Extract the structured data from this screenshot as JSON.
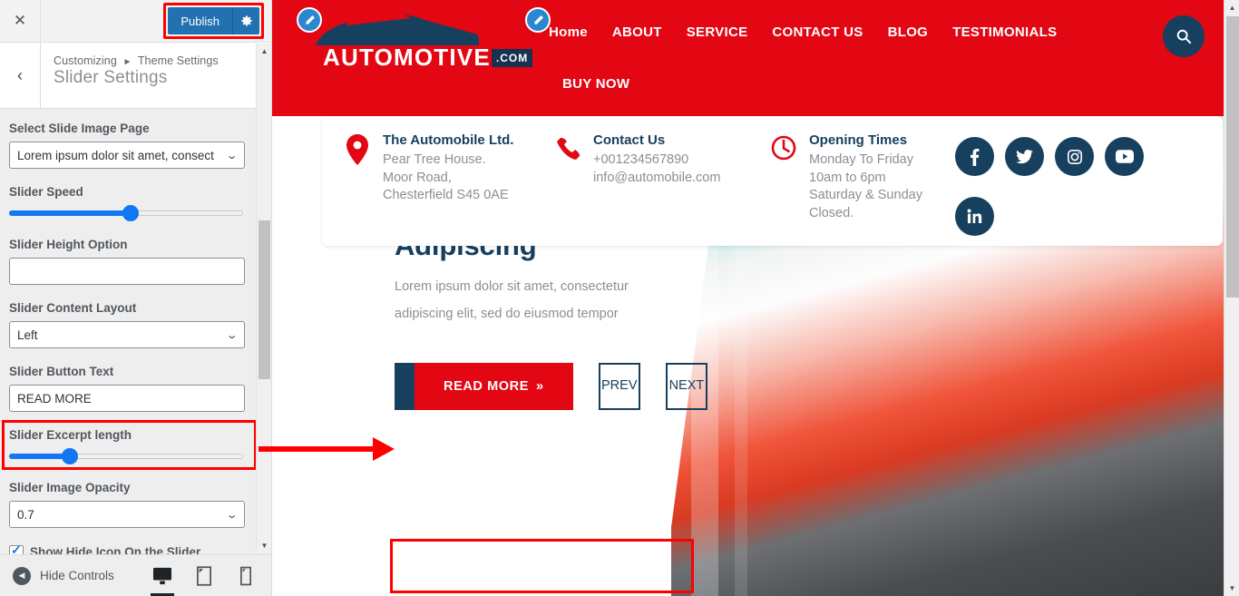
{
  "customizer": {
    "close_label": "✕",
    "publish_label": "Publish",
    "gear_icon": "gear-icon",
    "back_label": "‹",
    "breadcrumb_root": "Customizing",
    "breadcrumb_sep": "►",
    "breadcrumb_section": "Theme Settings",
    "panel_title": "Slider Settings",
    "controls": [
      {
        "label": "Select Slide Image Page",
        "type": "select",
        "value": "Lorem ipsum dolor sit amet, consect"
      },
      {
        "label": "Slider Speed",
        "type": "range",
        "percent": 52
      },
      {
        "label": "Slider Height Option",
        "type": "text",
        "value": ""
      },
      {
        "label": "Slider Content Layout",
        "type": "select",
        "value": "Left"
      },
      {
        "label": "Slider Button Text",
        "type": "text",
        "value": "READ MORE"
      },
      {
        "label": "Slider Excerpt length",
        "type": "range",
        "percent": 26
      },
      {
        "label": "Slider Image Opacity",
        "type": "select",
        "value": "0.7"
      },
      {
        "label": "Show  Hide Icon On the Slider",
        "type": "checkbox",
        "checked": true
      }
    ],
    "footer": {
      "hide_controls_label": "Hide Controls",
      "devices": [
        {
          "name": "desktop",
          "active": true
        },
        {
          "name": "tablet",
          "active": false
        },
        {
          "name": "mobile",
          "active": false
        }
      ]
    },
    "highlight_color": "#ff0000",
    "accent_color": "#2271b1",
    "slider_color": "#1177f2"
  },
  "preview": {
    "brand": {
      "name": "AUTOMOTIVE",
      "suffix": ".COM",
      "logo_icon": "car-silhouette-icon"
    },
    "header_bg": "#e30613",
    "navy": "#17405f",
    "edit_pins": [
      {
        "name": "logo-edit-pin",
        "icon": "pencil-icon"
      },
      {
        "name": "menu-edit-pin",
        "icon": "pencil-icon"
      }
    ],
    "nav": [
      "Home",
      "ABOUT",
      "SERVICE",
      "CONTACT US",
      "BLOG",
      "TESTIMONIALS"
    ],
    "nav_second_row": "BUY NOW",
    "search_icon": "search-icon",
    "info_card": {
      "address": {
        "icon": "map-pin-icon",
        "title": "The Automobile Ltd.",
        "lines": [
          "Pear Tree House.",
          "Moor Road,",
          "Chesterfield S45 0AE"
        ]
      },
      "contact": {
        "icon": "phone-icon",
        "title": "Contact Us",
        "lines": [
          "+001234567890",
          "info@automobile.com"
        ]
      },
      "hours": {
        "icon": "clock-icon",
        "title": "Opening Times",
        "lines": [
          "Monday To Friday",
          "10am to 6pm",
          "Saturday & Sunday",
          "Closed."
        ]
      },
      "socials": [
        {
          "name": "facebook-icon",
          "glyph": "f"
        },
        {
          "name": "twitter-icon",
          "glyph": "t"
        },
        {
          "name": "instagram-icon",
          "glyph": "i"
        },
        {
          "name": "youtube-icon",
          "glyph": "y"
        },
        {
          "name": "linkedin-icon",
          "glyph": "in"
        }
      ]
    },
    "slide": {
      "title": "Lorem Ipsum Dolor Sit Amet, Consectetur Adipiscing",
      "excerpt": "Lorem ipsum dolor sit amet, consectetur adipiscing elit, sed do eiusmod tempor",
      "button_label": "READ MORE",
      "button_arrow": "»",
      "prev_label": "PREV",
      "next_label": "NEXT"
    }
  }
}
